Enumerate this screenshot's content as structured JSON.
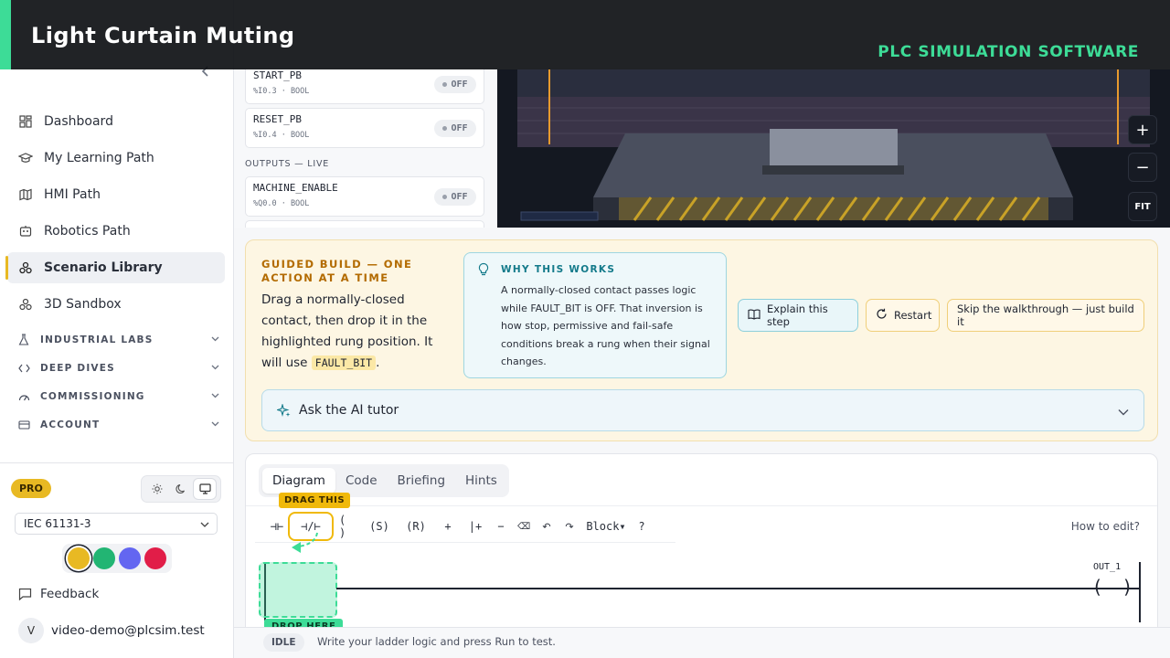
{
  "overlay": {
    "title": "Light Curtain Muting",
    "subtitle": "PLC SIMULATION SOFTWARE"
  },
  "colors": {
    "accent_gold": "#e8b923",
    "accent_green": "#3ddc97",
    "teal": "#137a8a"
  },
  "sidebar": {
    "collapse_icon": "chevron-left-icon",
    "items": [
      {
        "label": "Dashboard",
        "icon": "dashboard-icon"
      },
      {
        "label": "My Learning Path",
        "icon": "graduation-cap-icon"
      },
      {
        "label": "HMI Path",
        "icon": "map-icon"
      },
      {
        "label": "Robotics Path",
        "icon": "robot-icon"
      },
      {
        "label": "Scenario Library",
        "icon": "scenario-icon",
        "active": true
      },
      {
        "label": "3D Sandbox",
        "icon": "cube-icon"
      }
    ],
    "sections": [
      {
        "label": "INDUSTRIAL LABS",
        "icon": "flask-icon"
      },
      {
        "label": "DEEP DIVES",
        "icon": "code-icon"
      },
      {
        "label": "COMMISSIONING",
        "icon": "gauge-icon"
      },
      {
        "label": "ACCOUNT",
        "icon": "card-icon"
      }
    ],
    "plan_badge": "PRO",
    "standard": "IEC 61131-3",
    "swatches": [
      "#e8b923",
      "#22b573",
      "#6366f1",
      "#e11d48"
    ],
    "feedback": "Feedback",
    "user": {
      "initial": "V",
      "email": "video-demo@plcsim.test"
    }
  },
  "io": {
    "inputs": [
      {
        "name": "START_PB",
        "addr": "%I0.3 · BOOL",
        "state": "OFF"
      },
      {
        "name": "RESET_PB",
        "addr": "%I0.4 · BOOL",
        "state": "OFF"
      }
    ],
    "outputs_heading": "OUTPUTS — LIVE",
    "outputs": [
      {
        "name": "MACHINE_ENABLE",
        "addr": "%Q0.0 · BOOL",
        "state": "OFF"
      }
    ]
  },
  "viewport": {
    "zoom_in": "+",
    "zoom_out": "−",
    "fit": "FIT"
  },
  "guided": {
    "heading": "GUIDED BUILD — ONE ACTION AT A TIME",
    "body_text": "Drag a normally-closed contact, then drop it in the highlighted rung position. It will use",
    "body_code": "FAULT_BIT",
    "body_end": ".",
    "why_heading": "WHY THIS WORKS",
    "why_body": "A normally-closed contact passes logic while FAULT_BIT is OFF. That inversion is how stop, permissive and fail-safe conditions break a rung when their signal changes.",
    "explain_label": "Explain this step",
    "restart_label": "Restart",
    "skip_label": "Skip the walkthrough — just build it",
    "ai_tutor_label": "Ask the AI tutor"
  },
  "editor": {
    "tabs": [
      "Diagram",
      "Code",
      "Briefing",
      "Hints"
    ],
    "active_tab": "Diagram",
    "drag_tip": "DRAG THIS",
    "tools": [
      "⊣⊢",
      "⊣/⊢",
      "( )",
      "(S)",
      "(R)",
      "+",
      "|+",
      "−",
      "⌫",
      "↶",
      "↷",
      "Block▾",
      "?"
    ],
    "how_to_edit": "How to edit?",
    "drop_label": "DROP HERE",
    "coil_label": "OUT_1",
    "coil_symbol": "( )"
  },
  "status": {
    "state": "IDLE",
    "message": "Write your ladder logic and press Run to test."
  }
}
